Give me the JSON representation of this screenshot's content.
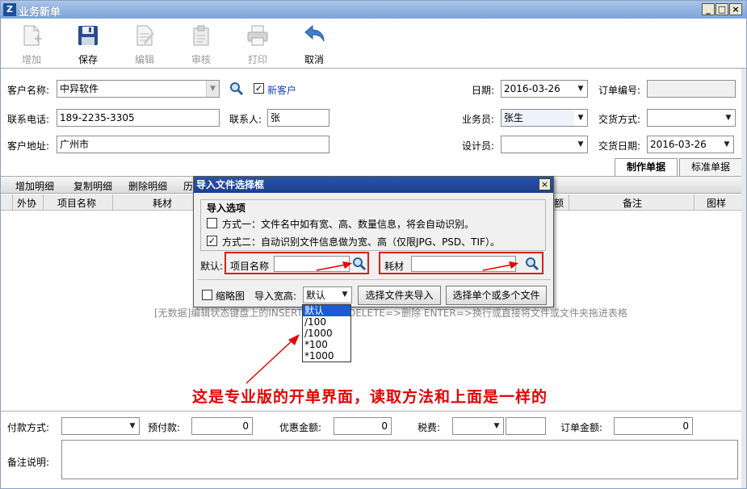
{
  "window": {
    "title": "业务新单",
    "controls": [
      "_",
      "□",
      "×"
    ]
  },
  "toolbar": {
    "buttons": [
      {
        "label": "增加",
        "icon": "add-doc-icon",
        "enabled": false
      },
      {
        "label": "保存",
        "icon": "save-icon",
        "enabled": true
      },
      {
        "label": "编辑",
        "icon": "edit-icon",
        "enabled": false
      },
      {
        "label": "审核",
        "icon": "review-icon",
        "enabled": false
      },
      {
        "label": "打印",
        "icon": "print-icon",
        "enabled": false
      },
      {
        "label": "取消",
        "icon": "undo-icon",
        "enabled": true
      }
    ]
  },
  "form": {
    "customer_name_label": "客户名称:",
    "customer_name_value": "中异软件",
    "new_customer_label": "新客户",
    "new_customer_checked": true,
    "phone_label": "联系电话:",
    "phone_value": "189-2235-3305",
    "contact_label": "联系人:",
    "contact_value": "张",
    "address_label": "客户地址:",
    "address_value": "广州市",
    "date_label": "日期:",
    "date_value": "2016-03-26",
    "order_no_label": "订单编号:",
    "order_no_value": "",
    "salesman_label": "业务员:",
    "salesman_value": "张生",
    "delivery_method_label": "交货方式:",
    "delivery_method_value": "",
    "designer_label": "设计员:",
    "designer_value": "",
    "delivery_date_label": "交货日期:",
    "delivery_date_value": "2016-03-26"
  },
  "tabs": [
    {
      "label": "制作单据",
      "active": true
    },
    {
      "label": "标准单据",
      "active": false
    }
  ],
  "grid": {
    "actions": [
      "增加明细",
      "复制明细",
      "删除明细",
      "历"
    ],
    "columns": [
      "外协",
      "项目名称",
      "耗材",
      "额",
      "备注",
      "图样"
    ],
    "empty_text": "[无数据]编辑状态键盘上的INSERT=>插入，DELETE=>删除 ENTER=>换行或直接将文件或文件夹拖进表格"
  },
  "footer": {
    "payment_method_label": "付款方式:",
    "payment_method_value": "",
    "prepay_label": "预付款:",
    "prepay_value": "0",
    "discount_label": "优惠金额:",
    "discount_value": "0",
    "tax_label": "税费:",
    "tax_value": "",
    "tax_amount_value": "",
    "order_amount_label": "订单金额:",
    "order_amount_value": "0",
    "remark_label": "备注说明:",
    "remark_value": ""
  },
  "dialog": {
    "title": "导入文件选择框",
    "group_title": "导入选项",
    "option1_label": "方式一：文件名中如有宽、高、数量信息，将会自动识别。",
    "option1_checked": false,
    "option2_label": "方式二：自动识别文件信息做为宽、高（仅限JPG、PSD、TIF）。",
    "option2_checked": true,
    "default_label": "默认:",
    "project_name_label": "项目名称",
    "project_name_value": "",
    "material_label": "耗材",
    "material_value": "",
    "thumbnail_label": "缩略图",
    "thumbnail_checked": false,
    "import_size_label": "导入宽高:",
    "import_size_value": "默认",
    "btn_folder_import": "选择文件夹导入",
    "btn_select_files": "选择单个或多个文件",
    "import_size_options": [
      "默认",
      "/100",
      "/1000",
      "*100",
      "*1000"
    ],
    "import_size_highlighted": "默认"
  },
  "annotation": {
    "text": "这是专业版的开单界面，读取方法和上面是一样的",
    "color": "#e60000"
  }
}
